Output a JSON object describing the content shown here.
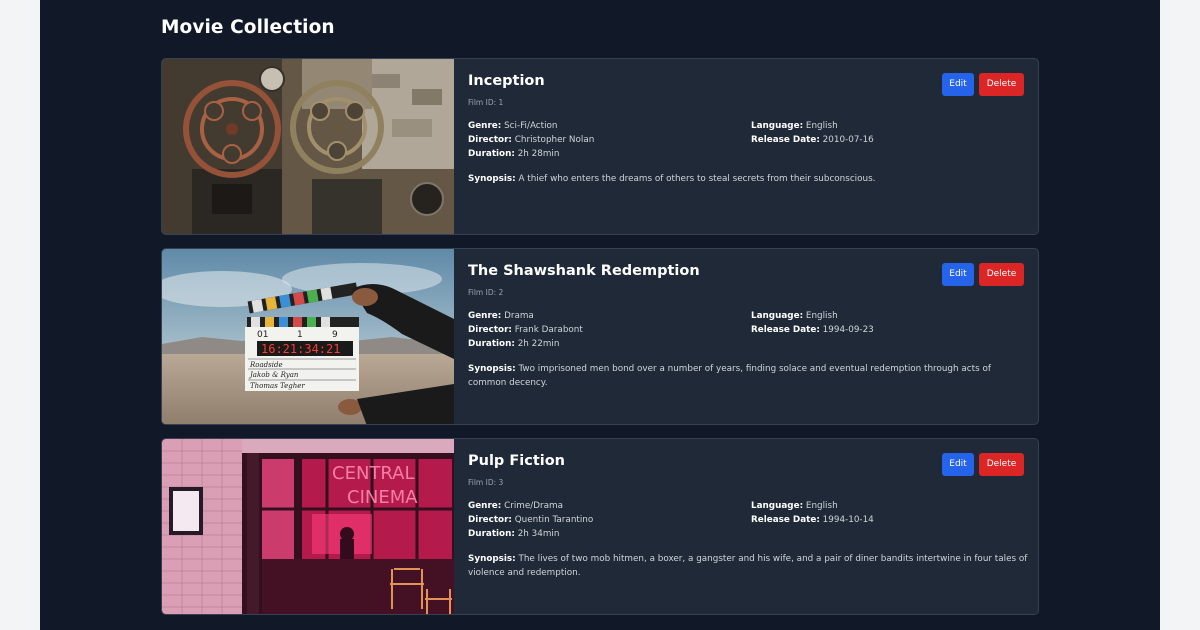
{
  "page": {
    "title": "Movie Collection"
  },
  "labels": {
    "edit": "Edit",
    "delete": "Delete",
    "genre": "Genre:",
    "director": "Director:",
    "duration": "Duration:",
    "language": "Language:",
    "release_date": "Release Date:",
    "synopsis": "Synopsis:"
  },
  "movies": [
    {
      "title": "Inception",
      "film_id": "Film ID: 1",
      "genre": "Sci-Fi/Action",
      "director": "Christopher Nolan",
      "duration": "2h 28min",
      "language": "English",
      "release_date": "2010-07-16",
      "synopsis": "A thief who enters the dreams of others to steal secrets from their subconscious."
    },
    {
      "title": "The Shawshank Redemption",
      "film_id": "Film ID: 2",
      "genre": "Drama",
      "director": "Frank Darabont",
      "duration": "2h 22min",
      "language": "English",
      "release_date": "1994-09-23",
      "synopsis": "Two imprisoned men bond over a number of years, finding solace and eventual redemption through acts of common decency."
    },
    {
      "title": "Pulp Fiction",
      "film_id": "Film ID: 3",
      "genre": "Crime/Drama",
      "director": "Quentin Tarantino",
      "duration": "2h 34min",
      "language": "English",
      "release_date": "1994-10-14",
      "synopsis": "The lives of two mob hitmen, a boxer, a gangster and his wife, and a pair of diner bandits intertwine in four tales of violence and redemption."
    }
  ],
  "images": [
    {
      "subject": "film-projector-reels"
    },
    {
      "subject": "clapperboard",
      "clapper_text": [
        "01",
        "1",
        "9",
        "16:21:34:21",
        "Roadside",
        "Jakob & Ryan",
        "Thomas Tegher"
      ]
    },
    {
      "subject": "neon-cinema",
      "neon_text": [
        "CENTRAL",
        "CINEMA"
      ]
    }
  ],
  "colors": {
    "page_bg": "#111827",
    "card_bg": "#1f2937",
    "edit_button": "#2563eb",
    "delete_button": "#dc2626"
  }
}
